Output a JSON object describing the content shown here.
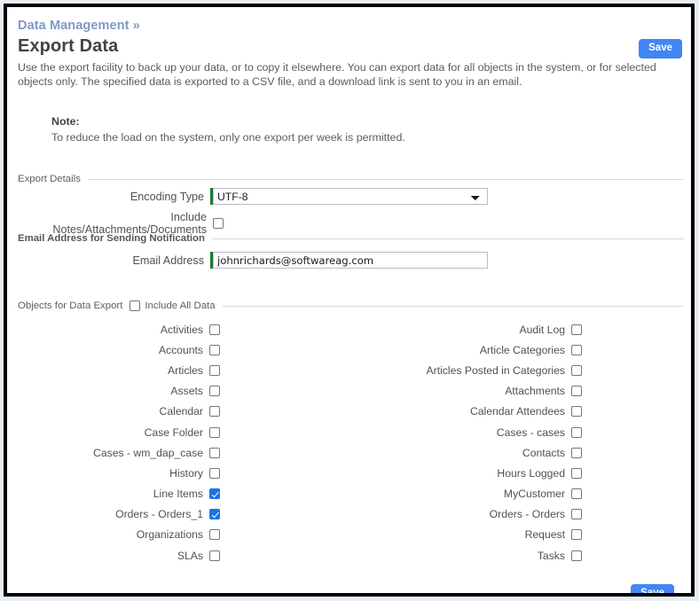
{
  "header": {
    "breadcrumb": "Data Management »",
    "title": "Export Data",
    "save_label": "Save"
  },
  "intro": {
    "text": "Use the export facility to back up your data, or to copy it elsewhere. You can export data for all objects in the system, or for selected objects only. The specified data is exported to a CSV file, and a download link is sent to you in an email."
  },
  "note": {
    "title": "Note:",
    "text": "To reduce the load on the system, only one export per week is permitted."
  },
  "export_details": {
    "section_title": "Export Details",
    "encoding_label": "Encoding Type",
    "encoding_value": "UTF-8",
    "encoding_options": [
      "UTF-8"
    ],
    "include_notes_label": "Include Notes/Attachments/Documents",
    "include_notes_checked": false
  },
  "email_section": {
    "section_title": "Email Address for Sending Notification",
    "email_label": "Email Address",
    "email_value": "johnrichards@softwareag.com",
    "email_placeholder": ""
  },
  "objects_section": {
    "section_title": "Objects for Data Export",
    "include_all_label": "Include All Data",
    "include_all_checked": false,
    "left_column": [
      {
        "label": "Activities",
        "checked": false
      },
      {
        "label": "Accounts",
        "checked": false
      },
      {
        "label": "Articles",
        "checked": false
      },
      {
        "label": "Assets",
        "checked": false
      },
      {
        "label": "Calendar",
        "checked": false
      },
      {
        "label": "Case Folder",
        "checked": false
      },
      {
        "label": "Cases - wm_dap_case",
        "checked": false
      },
      {
        "label": "History",
        "checked": false
      },
      {
        "label": "Line Items",
        "checked": true
      },
      {
        "label": "Orders - Orders_1",
        "checked": true
      },
      {
        "label": "Organizations",
        "checked": false
      },
      {
        "label": "SLAs",
        "checked": false
      }
    ],
    "right_column": [
      {
        "label": "Audit Log",
        "checked": false
      },
      {
        "label": "Article Categories",
        "checked": false
      },
      {
        "label": "Articles Posted in Categories",
        "checked": false
      },
      {
        "label": "Attachments",
        "checked": false
      },
      {
        "label": "Calendar Attendees",
        "checked": false
      },
      {
        "label": "Cases - cases",
        "checked": false
      },
      {
        "label": "Contacts",
        "checked": false
      },
      {
        "label": "Hours Logged",
        "checked": false
      },
      {
        "label": "MyCustomer",
        "checked": false
      },
      {
        "label": "Orders - Orders",
        "checked": false
      },
      {
        "label": "Request",
        "checked": false
      },
      {
        "label": "Tasks",
        "checked": false
      }
    ]
  },
  "footer": {
    "save_label": "Save"
  },
  "colors": {
    "accent_blue": "#4285f4",
    "checkbox_blue": "#1a73e8",
    "required_green": "#1d7a32",
    "breadcrumb_blue": "#8298c6",
    "frame_black": "#000000"
  }
}
